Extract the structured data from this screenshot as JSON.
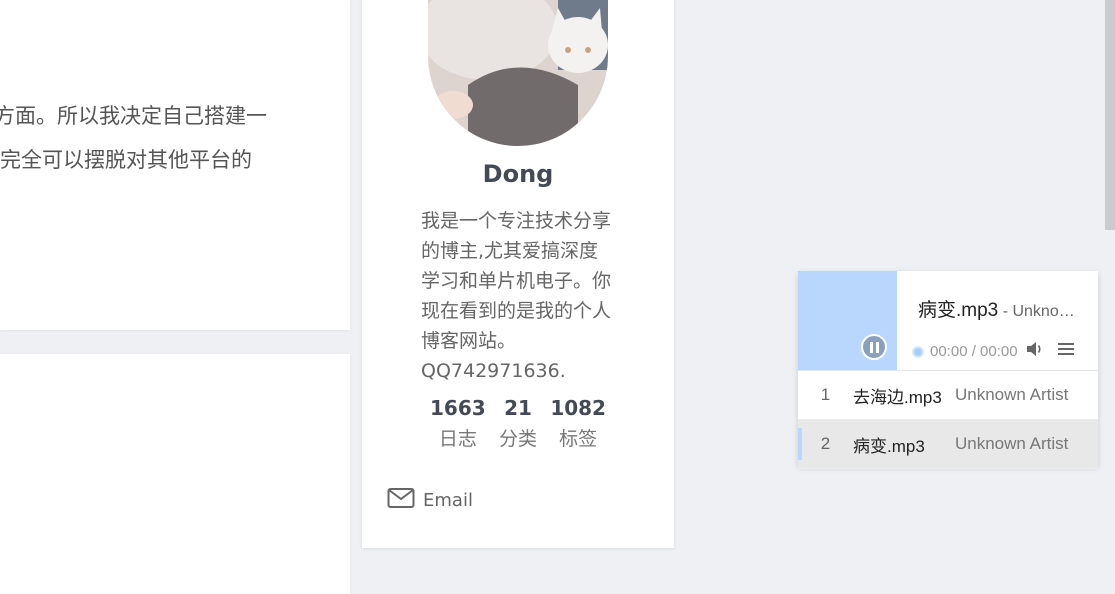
{
  "article": {
    "line1": "方面。所以我决定自己搭建一",
    "line2": "完全可以摆脱对其他平台的"
  },
  "author": {
    "name": "Dong",
    "description": "我是一个专注技术分享的博主,尤其爱搞深度学习和单片机电子。你现在看到的是我的个人博客网站。QQ742971636.",
    "stats": [
      {
        "count": "1663",
        "label": "日志"
      },
      {
        "count": "21",
        "label": "分类"
      },
      {
        "count": "1082",
        "label": "标签"
      }
    ],
    "email_label": "Email",
    "icons": {
      "email": "envelope-icon"
    }
  },
  "player": {
    "now_playing_title": "病变.mp3",
    "now_playing_artist": " - Unknown Artist",
    "time": "00:00 / 00:00",
    "accent_color": "#b9d6fc",
    "icons": {
      "pause": "pause-icon",
      "volume": "volume-icon",
      "menu": "menu-icon"
    },
    "playlist": [
      {
        "index": "1",
        "title": "去海边.mp3",
        "artist": "Unknown Artist",
        "active": false
      },
      {
        "index": "2",
        "title": "病变.mp3",
        "artist": "Unknown Artist",
        "active": true
      }
    ]
  }
}
